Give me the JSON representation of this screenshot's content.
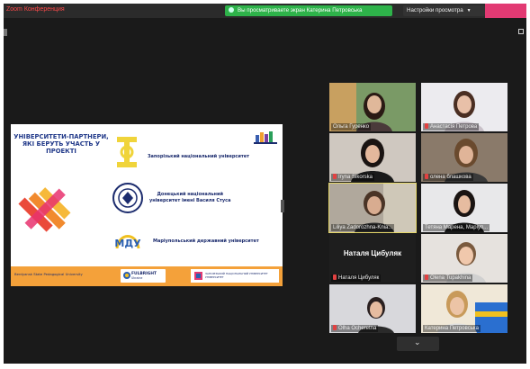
{
  "titlebar": {
    "title": "Zoom Конференция",
    "share_notice": "Вы просматриваете экран Катерина Петровська",
    "view_options": "Настройки просмотра",
    "view_options_icon": "chevron-down-icon"
  },
  "slide": {
    "title_lines": [
      "УНІВЕРСИТЕТИ-ПАРТНЕРИ,",
      "ЯКІ БЕРУТЬ УЧАСТЬ У",
      "ПРОЕКТІ"
    ],
    "uni_1": "Запорізький національний університет",
    "uni_2_line1": "Донецький національний",
    "uni_2_line2": "університет імені Василя Стуса",
    "uni_3": "Маріупольський державний університет",
    "footer_left": "Berdyansk State Pedagogical University",
    "fulbright": "FULBRIGHT",
    "fulbright_sub": "Ukraine",
    "partner_line1": "ЗАПОРІЗЬКИЙ НАЦІОНАЛЬНИЙ УНІВЕРСИТЕТ",
    "partner_line2": "УНІВЕРСИТЕТ",
    "colors": {
      "footer": "#f4a13a",
      "title": "#223a8a"
    }
  },
  "participants": [
    {
      "name": "Ольга Гуренко",
      "muted": false
    },
    {
      "name": "Анастасія Петрова",
      "muted": true
    },
    {
      "name": "Iryna Sikorska",
      "muted": true
    },
    {
      "name": "олена блашкова",
      "muted": true
    },
    {
      "name": "Liliya Zadorozhna-Knia...",
      "muted": false,
      "active": true
    },
    {
      "name": "Тетяна Марена, Маріуп...",
      "muted": false
    },
    {
      "name": "Наталя Цибуляк",
      "muted": true,
      "display_name": "Наталя Цибуляк"
    },
    {
      "name": "Olena Tupakhina",
      "muted": true
    },
    {
      "name": "Olha Ocheretna",
      "muted": true
    },
    {
      "name": "Катерина Петровська",
      "muted": false
    }
  ]
}
